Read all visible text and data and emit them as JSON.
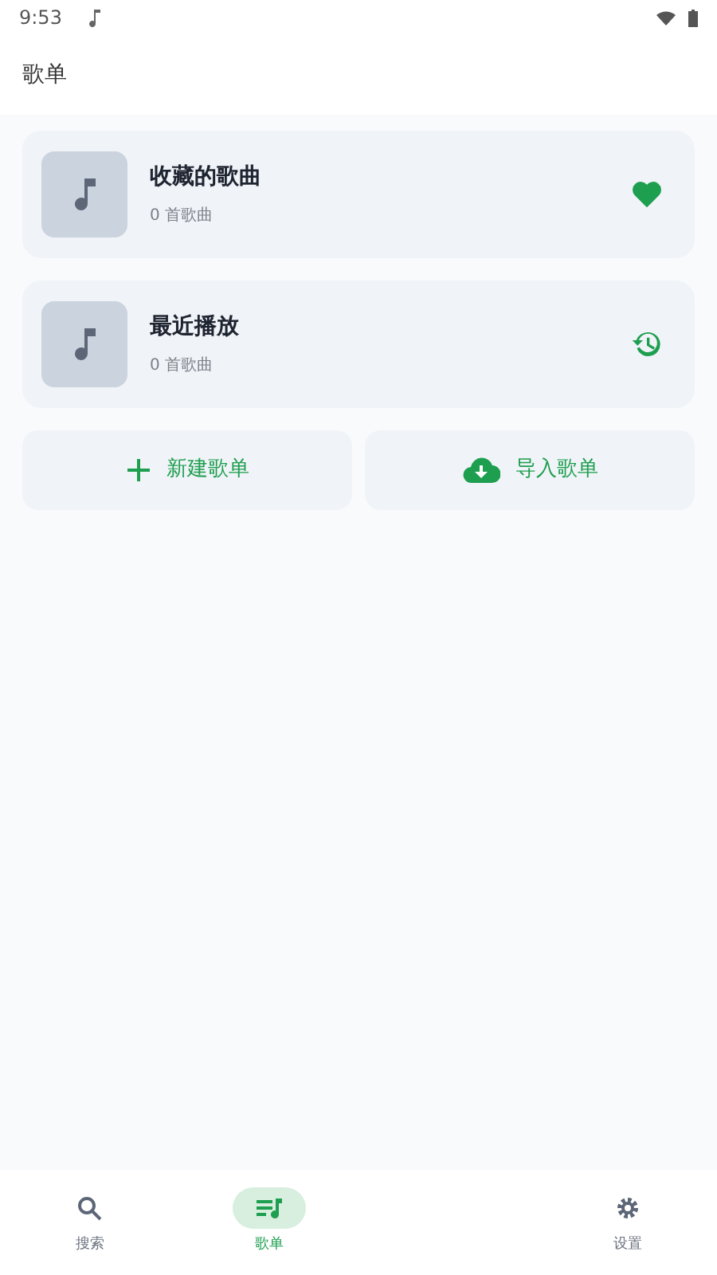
{
  "status_bar": {
    "time": "9:53"
  },
  "app_bar": {
    "title": "歌单"
  },
  "playlists": [
    {
      "kind": "favorites",
      "title": "收藏的歌曲",
      "count": "0 首歌曲"
    },
    {
      "kind": "recent",
      "title": "最近播放",
      "count": "0 首歌曲"
    }
  ],
  "actions": [
    {
      "kind": "create",
      "label": "新建歌单"
    },
    {
      "kind": "import",
      "label": "导入歌单"
    }
  ],
  "bottom_nav": [
    {
      "kind": "search",
      "label": "搜索",
      "selected": false
    },
    {
      "kind": "playlist",
      "label": "歌单",
      "selected": true
    },
    {
      "kind": "hidden"
    },
    {
      "kind": "settings",
      "label": "设置",
      "selected": false
    }
  ]
}
